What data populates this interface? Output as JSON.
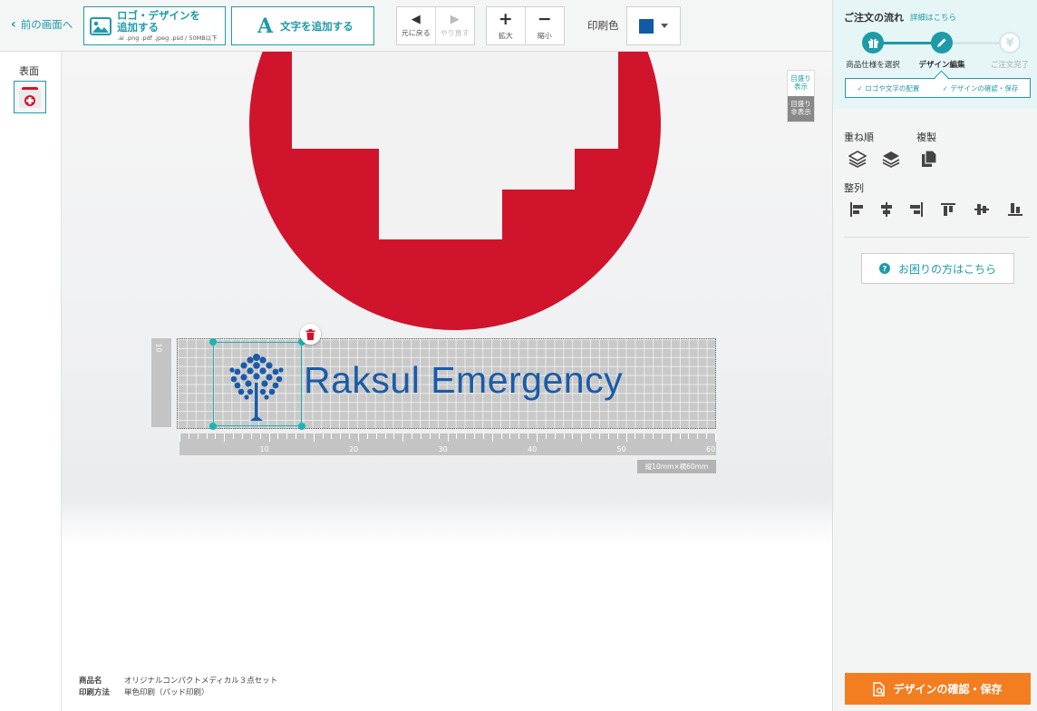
{
  "toolbar": {
    "back_label": "前の画面へ",
    "add_logo_line1": "ロゴ・デザインを",
    "add_logo_line2": "追加する",
    "add_logo_formats": ".ai .png .pdf .jpeg .psd / 50MB以下",
    "add_text_label": "文字を追加する",
    "undo_label": "元に戻る",
    "redo_label": "やり直す",
    "zoom_in_label": "拡大",
    "zoom_out_label": "縮小",
    "print_color_label": "印刷色",
    "print_color_value": "#0f5ba5"
  },
  "sidebar": {
    "face_label": "表面"
  },
  "canvas": {
    "toggle_show": "目盛り表示",
    "toggle_hide": "目盛り非表示",
    "design_text": "Raksul Emergency",
    "design_text_color": "#1a5ba8",
    "ruler_v_label": "10",
    "ruler_h_labels": [
      "10",
      "20",
      "30",
      "40",
      "50",
      "60"
    ],
    "dimension_label": "縦10mm×横60mm"
  },
  "product_info": {
    "name_key": "商品名",
    "name_value": "オリジナルコンパクトメディカル３点セット",
    "method_key": "印刷方法",
    "method_value": "単色印刷（パッド印刷）"
  },
  "panel": {
    "flow_title": "ご注文の流れ",
    "flow_detail_link": "詳細はこちら",
    "steps": [
      {
        "label": "商品仕様を選択",
        "icon": "gift-icon"
      },
      {
        "label": "デザイン編集",
        "icon": "pencil-icon"
      },
      {
        "label": "ご注文完了",
        "icon": "yen-icon"
      }
    ],
    "check1": "✓ ロゴや文字の配置",
    "check2": "✓ デザインの確認・保存",
    "layer_order_label": "重ね順",
    "duplicate_label": "複製",
    "align_label": "整列",
    "help_label": "お困りの方はこちら",
    "confirm_label": "デザインの確認・保存"
  },
  "colors": {
    "accent": "#1e9ba8",
    "cta": "#f37e21",
    "cross_red": "#d0142c"
  }
}
